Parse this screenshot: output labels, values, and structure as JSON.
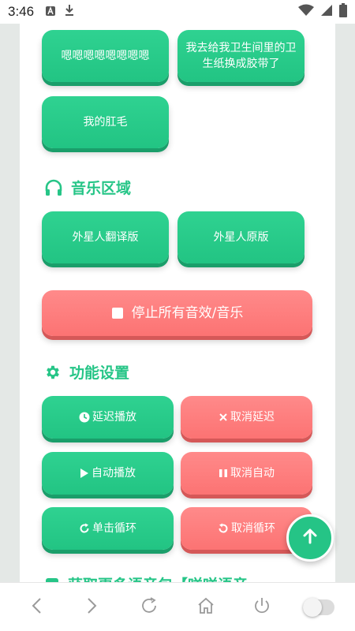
{
  "status_bar": {
    "time": "3:46"
  },
  "sound_buttons": [
    {
      "label": "嗯嗯嗯嗯嗯嗯嗯嗯"
    },
    {
      "label": "我去给我卫生间里的卫生纸换成胶带了"
    },
    {
      "label": "我的肛毛"
    }
  ],
  "music": {
    "title": "音乐区域",
    "buttons": [
      {
        "label": "外星人翻译版"
      },
      {
        "label": "外星人原版"
      }
    ],
    "stop_label": "停止所有音效/音乐"
  },
  "settings": {
    "title": "功能设置",
    "delay_play": "延迟播放",
    "cancel_delay": "取消延迟",
    "auto_play": "自动播放",
    "cancel_auto": "取消自动",
    "loop_play": "单击循环",
    "cancel_loop": "取消循环"
  },
  "next_section_peek": "获取更多语音包【咩咩语音",
  "colors": {
    "accent_green": "#26c587",
    "button_red": "#fc7373",
    "page_bg": "#e4e8e6"
  },
  "icons": {
    "headphones": "headphones-icon",
    "stop": "stop-icon",
    "gear": "gear-icon",
    "clock": "clock-icon",
    "close": "close-icon",
    "play": "play-icon",
    "pause": "pause-icon",
    "redo": "redo-icon",
    "undo": "undo-icon",
    "arrow_up": "arrow-up-icon"
  }
}
